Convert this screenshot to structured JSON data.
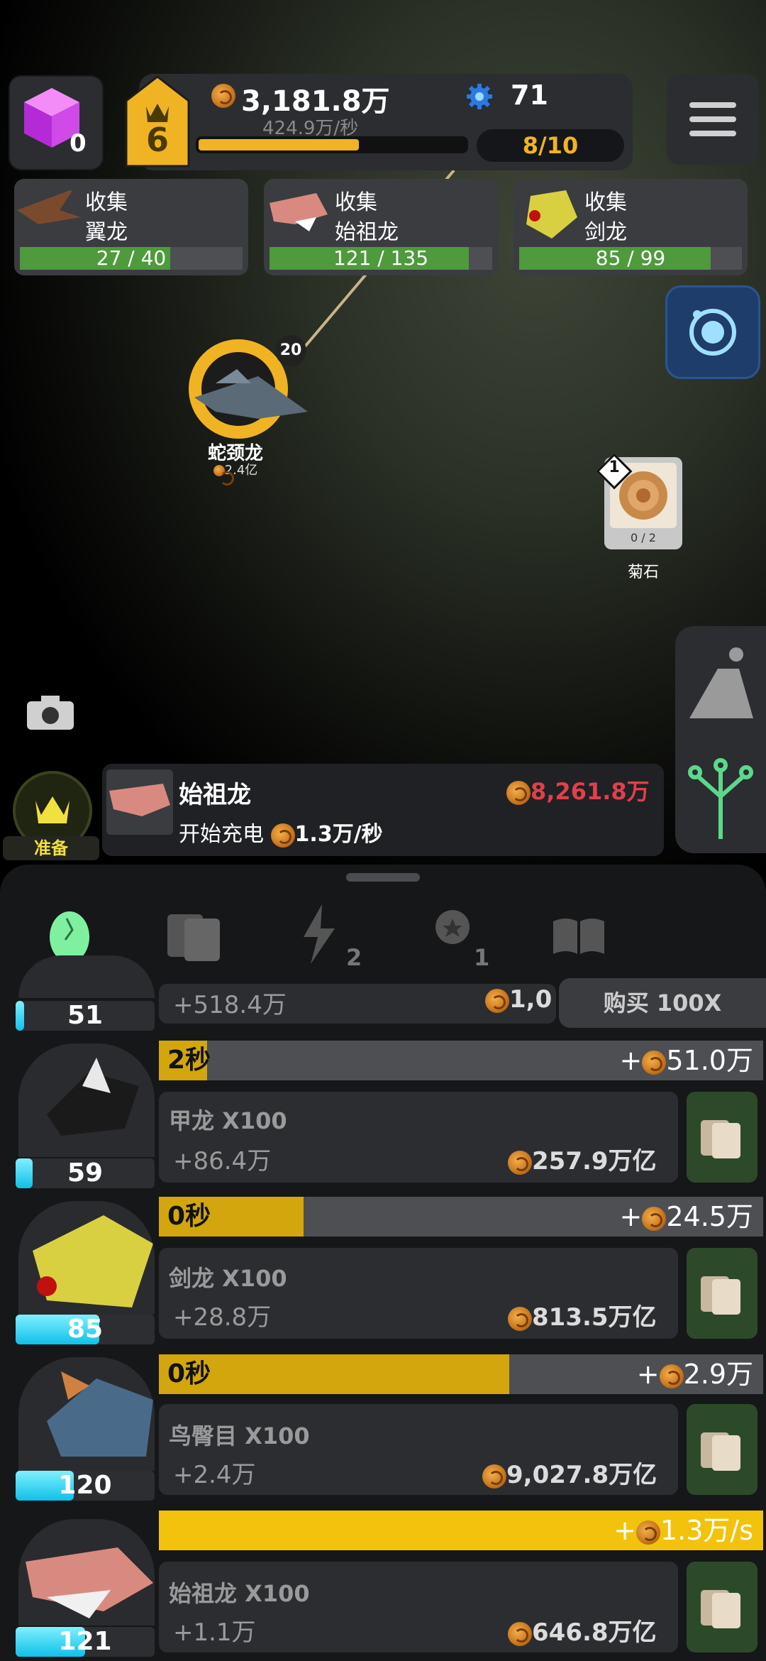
{
  "topbar": {
    "gems": "0",
    "level": "6",
    "coins": "3,181.8万",
    "coin_rate": "424.9万/秒",
    "gear_count": "71",
    "counter": "8/10",
    "level_progress": 0.6
  },
  "collect_cards": [
    {
      "label": "收集",
      "name": "翼龙",
      "progress": "27 / 40",
      "fraction": 0.675
    },
    {
      "label": "收集",
      "name": "始祖龙",
      "progress": "121 / 135",
      "fraction": 0.896
    },
    {
      "label": "收集",
      "name": "剑龙",
      "progress": "85 / 99",
      "fraction": 0.859
    }
  ],
  "map": {
    "dino_name": "蛇颈龙",
    "dino_value": "2.4亿",
    "dino_count": "20",
    "fossil_badge": "1",
    "fossil_count": "0 / 2",
    "fossil_name": "菊石"
  },
  "ready_label": "准备",
  "info_card": {
    "title": "始祖龙",
    "price": "8,261.8万",
    "sub_prefix": "开始充电",
    "sub_rate": "1.3万/秒"
  },
  "tabs": {
    "lightning_badge": "2",
    "medal_badge": "1"
  },
  "rows": [
    {
      "level": "51",
      "increment": "+518.4万",
      "price": "1,0",
      "buy": "购买 100X",
      "level_fill": 0.02
    },
    {
      "level": "59",
      "timer": "2秒",
      "timer_fill": 0.08,
      "gain": "51.0万",
      "name": "甲龙  X100",
      "increment": "+86.4万",
      "price": "257.9万亿",
      "level_fill": 0.12
    },
    {
      "level": "85",
      "timer": "0秒",
      "timer_fill": 0.24,
      "gain": "24.5万",
      "name": "剑龙  X100",
      "increment": "+28.8万",
      "price": "813.5万亿",
      "level_fill": 0.6
    },
    {
      "level": "120",
      "timer": "0秒",
      "timer_fill": 0.58,
      "gain": "2.9万",
      "name": "鸟臀目  X100",
      "increment": "+2.4万",
      "price": "9,027.8万亿",
      "level_fill": 0.42
    },
    {
      "level": "121",
      "gain": "1.3万/s",
      "name": "始祖龙  X100",
      "increment": "+1.1万",
      "price": "646.8万亿",
      "level_fill": 0.5
    }
  ],
  "colors": {
    "accent": "#f0b323",
    "green": "#4e9a3c",
    "cyan": "#10c0e8",
    "red": "#e0404a"
  }
}
